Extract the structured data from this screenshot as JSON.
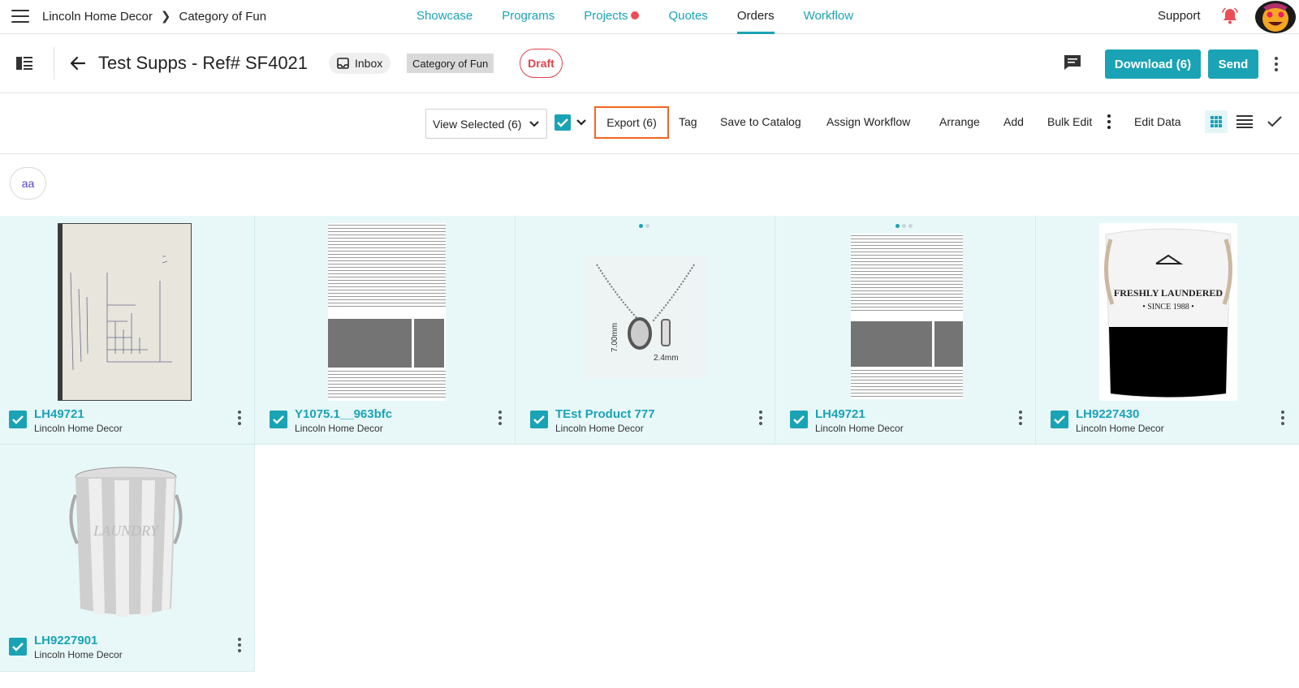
{
  "topnav": {
    "breadcrumb_root": "Lincoln Home Decor",
    "breadcrumb_current": "Category of Fun",
    "links": [
      {
        "label": "Showcase",
        "active": false
      },
      {
        "label": "Programs",
        "active": false
      },
      {
        "label": "Projects",
        "active": false,
        "badge": true
      },
      {
        "label": "Quotes",
        "active": false
      },
      {
        "label": "Orders",
        "active": true
      },
      {
        "label": "Workflow",
        "active": false
      }
    ],
    "support_label": "Support",
    "bell_icon": "bell-alert-icon",
    "avatar_icon": "emoji-avatar"
  },
  "header": {
    "title": "Test Supps - Ref# SF4021",
    "inbox_label": "Inbox",
    "category_label": "Category of Fun",
    "status_label": "Draft",
    "download_label": "Download (6)",
    "send_label": "Send"
  },
  "toolbar": {
    "view_selected_label": "View Selected (6)",
    "export_label": "Export (6)",
    "tag_label": "Tag",
    "save_catalog_label": "Save to Catalog",
    "assign_workflow_label": "Assign Workflow",
    "arrange_label": "Arrange",
    "add_label": "Add",
    "bulk_edit_label": "Bulk Edit",
    "edit_data_label": "Edit Data"
  },
  "tag_chip": "aa",
  "products": [
    {
      "name": "LH49721",
      "vendor": "Lincoln Home Decor",
      "image": "sketch-photo",
      "selected": true
    },
    {
      "name": "Y1075.1__963bfc",
      "vendor": "Lincoln Home Decor",
      "image": "sample-document",
      "selected": true
    },
    {
      "name": "TEst Product 777",
      "vendor": "Lincoln Home Decor",
      "image": "necklace-diagram",
      "selected": true,
      "image_dots": 2
    },
    {
      "name": "LH49721",
      "vendor": "Lincoln Home Decor",
      "image": "sample-document",
      "selected": true,
      "image_dots": 3
    },
    {
      "name": "LH9227430",
      "vendor": "Lincoln Home Decor",
      "image": "laundry-basket",
      "selected": true
    },
    {
      "name": "LH9227901",
      "vendor": "Lincoln Home Decor",
      "image": "striped-laundry-basket",
      "selected": true
    }
  ],
  "colors": {
    "accent": "#1aa3b5",
    "card_bg": "#e8f8f9",
    "danger": "#e0424b",
    "export_highlight": "#f26522"
  }
}
